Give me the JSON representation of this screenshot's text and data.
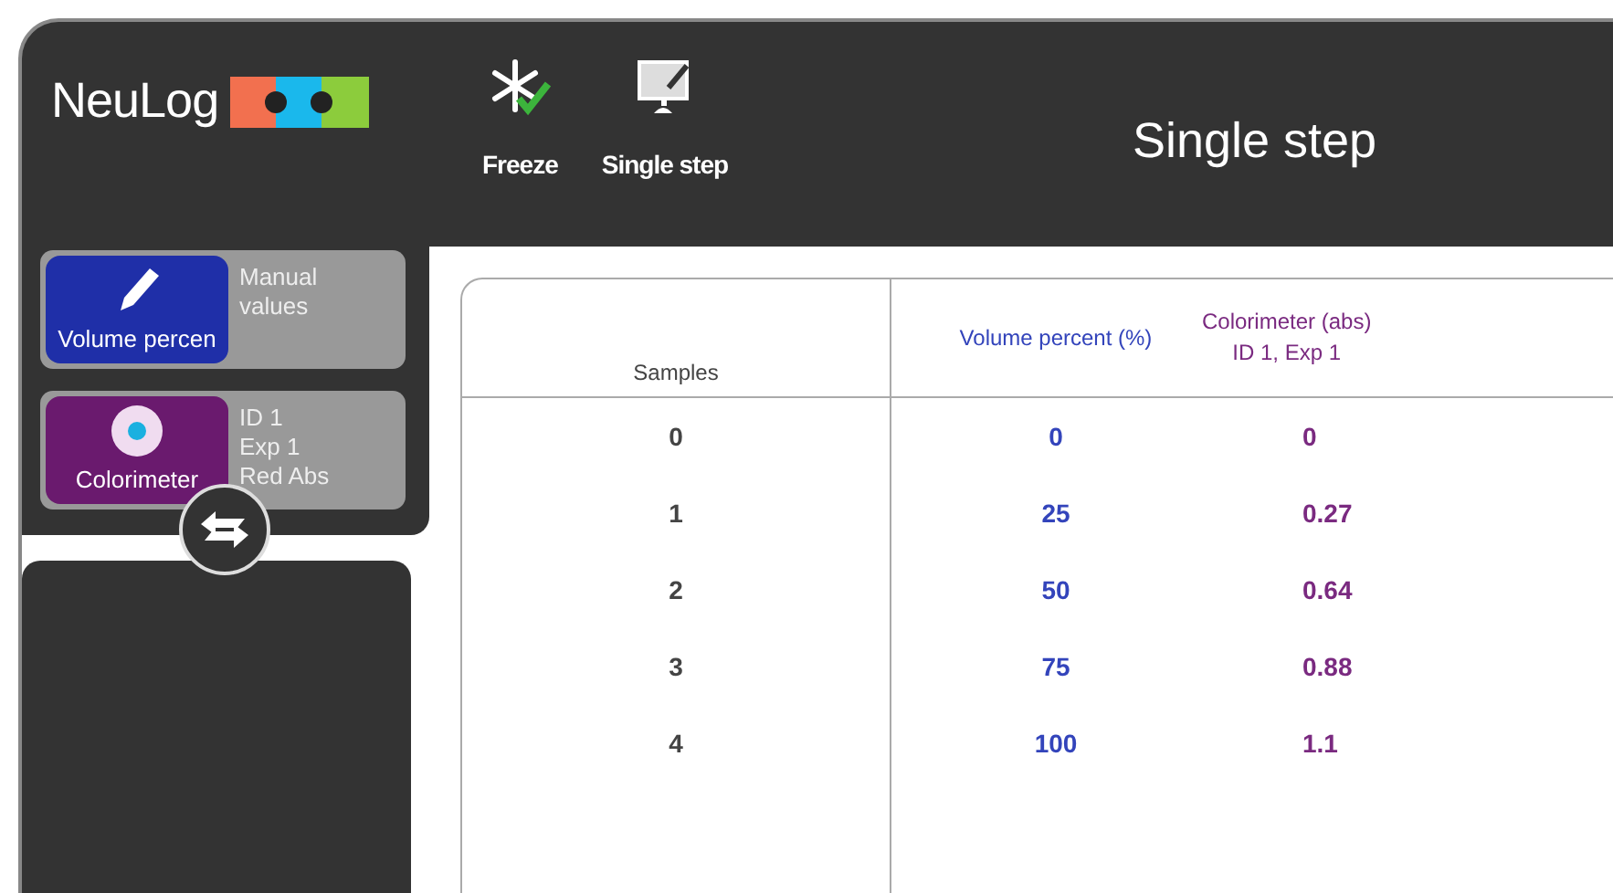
{
  "logo": {
    "text": "NeuLog"
  },
  "toolbar": [
    {
      "kind": "freeze",
      "label": "Freeze"
    },
    {
      "kind": "single-step",
      "label": "Single step"
    }
  ],
  "title": "Single step",
  "sensors": [
    {
      "kind": "manual",
      "name": "Volume percen",
      "color": "#1f2fa8",
      "info": [
        "Manual",
        "values"
      ]
    },
    {
      "kind": "colorimeter",
      "name": "Colorimeter",
      "color": "#6a1a6e",
      "info": [
        "ID 1",
        "Exp 1",
        "Red Abs"
      ]
    }
  ],
  "table": {
    "columns": [
      {
        "lines": [
          "Samples"
        ],
        "color": "#444444"
      },
      {
        "lines": [
          "Volume percent (%)"
        ],
        "color": "#3344bb"
      },
      {
        "lines": [
          "Colorimeter (abs)",
          "ID 1, Exp 1"
        ],
        "color": "#7a2a80"
      }
    ],
    "rows": [
      [
        "0",
        "0",
        "0"
      ],
      [
        "1",
        "25",
        "0.27"
      ],
      [
        "2",
        "50",
        "0.64"
      ],
      [
        "3",
        "75",
        "0.88"
      ],
      [
        "4",
        "100",
        "1.1"
      ]
    ]
  }
}
